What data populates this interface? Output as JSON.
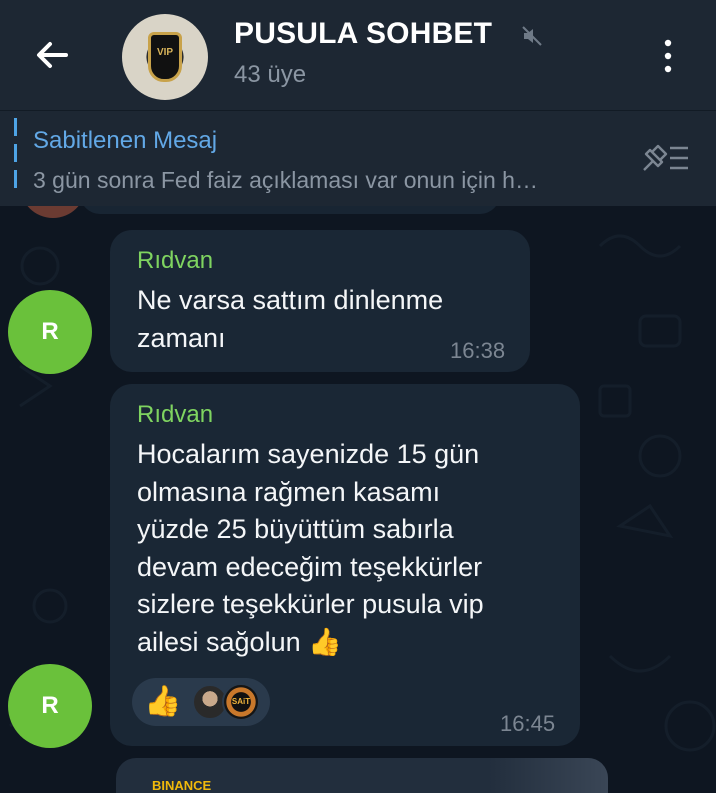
{
  "header": {
    "back_icon": "arrow-left-icon",
    "title": "PUSULA SOHBET",
    "muted_icon": "mute-icon",
    "subtitle": "43 üye",
    "avatar_lettering": "VIP",
    "menu_icon": "more-vertical-icon"
  },
  "pinned": {
    "title": "Sabitlenen Mesaj",
    "text": "3 gün sonra Fed faiz açıklaması var onun için h…",
    "icon": "pinned-list-icon"
  },
  "messages": [
    {
      "sender": "Rıdvan",
      "avatar_letter": "R",
      "lines": [
        "Ne varsa sattım dinlenme",
        "zamanı"
      ],
      "time": "16:38"
    },
    {
      "sender": "Rıdvan",
      "avatar_letter": "R",
      "lines": [
        "Hocalarım sayenizde 15 gün",
        "olmasına rağmen kasamı",
        "yüzde 25 büyüttüm sabırla",
        "devam edeceğim teşekkürler",
        "sizlere teşekkürler pusula vip",
        "ailesi sağolun 👍"
      ],
      "time": "16:45",
      "reaction_emoji": "👍",
      "reactor_badge": "SAiT"
    }
  ],
  "next_preview": {
    "label": "BINANCE"
  },
  "colors": {
    "header_bg": "#1d2733",
    "chat_bg": "#0e1621",
    "bubble_bg": "#1a2735",
    "sender_name": "#7fd460",
    "link_blue": "#62a8e6",
    "avatar_green": "#6ac13b"
  }
}
